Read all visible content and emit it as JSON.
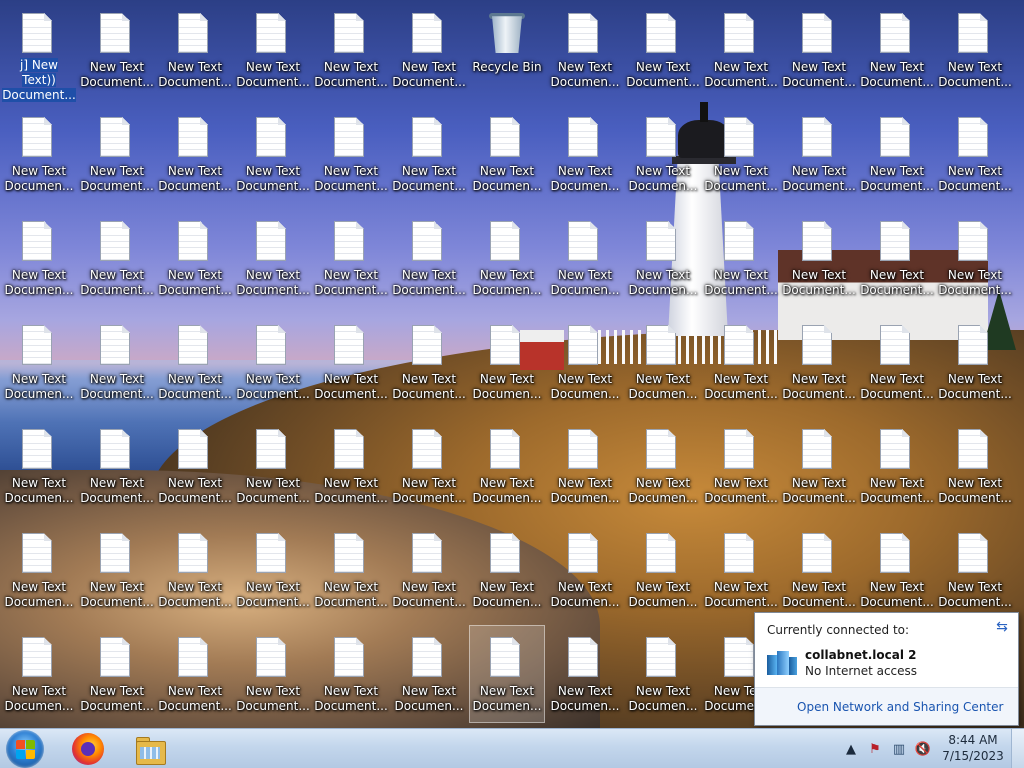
{
  "desktop": {
    "doc_icon_label_short": "New Text Document...",
    "doc_icon_label_clipped": "New Text Documen...",
    "first_icon_label": "j] New Text)) Document...",
    "recycle_bin_label": "Recycle Bin"
  },
  "network_popup": {
    "header": "Currently connected to:",
    "network_name": "collabnet.local  2",
    "network_status": "No Internet access",
    "link": "Open Network and Sharing Center"
  },
  "taskbar": {
    "start_icon": "windows-logo-icon",
    "pinned": [
      "firefox-icon",
      "file-explorer-icon"
    ],
    "tray_icons": [
      "show-hidden-icons-chevron-icon",
      "action-center-flag-icon",
      "network-icon",
      "volume-muted-icon"
    ],
    "clock_time": "8:44 AM",
    "clock_date": "7/15/2023"
  },
  "tray_chevron_glyph": "▲"
}
